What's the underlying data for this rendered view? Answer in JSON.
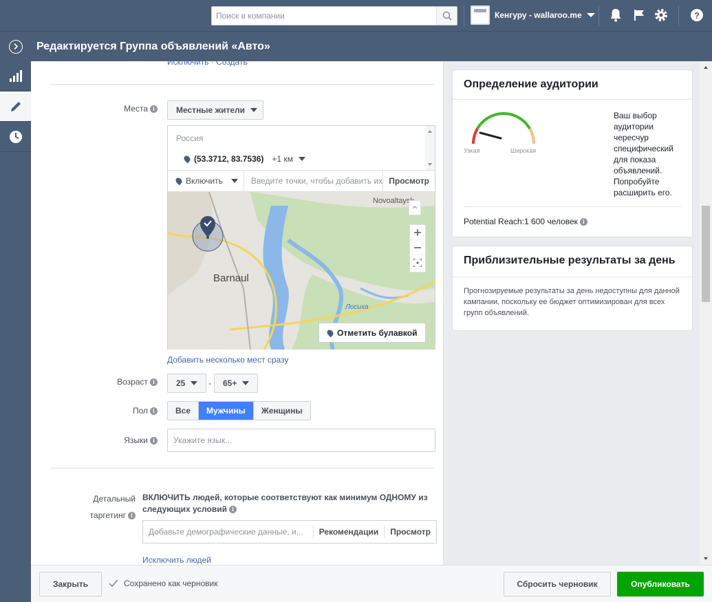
{
  "topbar": {
    "search_placeholder": "Поиск в компании",
    "account_name": "Кенгуру - wallaroo.me"
  },
  "title": "Редактируется Группа объявлений «Авто»",
  "form": {
    "partial_links": "Исключить · Создать",
    "places": {
      "label": "Места",
      "type_value": "Местные жители",
      "country": "Россия",
      "pin_coords": "(53.3712, 83.7536)",
      "radius": "+1 км",
      "include_label": "Включить",
      "input_placeholder": "Введите точки, чтобы добавить их",
      "browse_label": "Просмотр",
      "map_city": "Barnaul",
      "map_town": "Novoaltaysk",
      "map_river": "Лосиха",
      "drop_pin_label": "Отметить булавкой",
      "add_bulk_link": "Добавить несколько мест сразу"
    },
    "age": {
      "label": "Возраст",
      "min": "25",
      "max": "65+",
      "sep": "-"
    },
    "gender": {
      "label": "Пол",
      "options": [
        "Все",
        "Мужчины",
        "Женщины"
      ],
      "selected": "Мужчины"
    },
    "languages": {
      "label": "Языки",
      "placeholder": "Укажите язык..."
    },
    "detailed": {
      "label_line1": "Детальный",
      "label_line2": "таргетинг",
      "desc": "ВКЛЮЧИТЬ людей, которые соответствуют как минимум ОДНОМУ из следующих условий",
      "placeholder": "Добавьте демографические данные, и...",
      "recommend_label": "Рекомендации",
      "browse_label": "Просмотр",
      "exclude_link": "Исключить людей"
    }
  },
  "audience": {
    "title": "Определение аудитории",
    "narrow": "Узкая",
    "broad": "Широкая",
    "gauge_level": 0.15,
    "message": "Ваш выбор аудитории чересчур специфический для показа объявлений. Попробуйте расширить его.",
    "reach_label": "Potential Reach:",
    "reach_value": "1 600 человек"
  },
  "estimates": {
    "title": "Приблизительные результаты за день",
    "message": "Прогнозируемые результаты за день недоступны для данной кампании, поскольку ее бюджет оптимизирован для всех групп объявлений."
  },
  "bottombar": {
    "close_label": "Закрыть",
    "saved_status": "Сохранено как черновик",
    "reset_label": "Сбросить черновик",
    "publish_label": "Опубликовать"
  },
  "colors": {
    "header": "#4b5e78",
    "accent": "#4080ff",
    "publish": "#00a400",
    "link": "#4267b2"
  }
}
